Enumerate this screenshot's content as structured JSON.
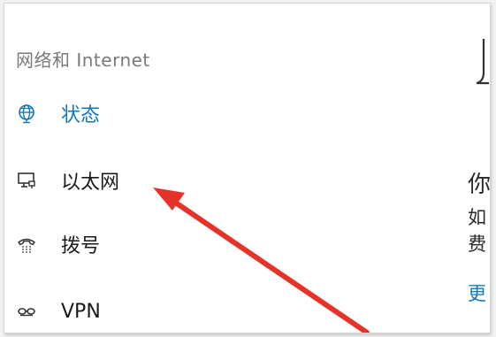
{
  "sidebar": {
    "section_title": "网络和 Internet",
    "items": [
      {
        "label": "状态",
        "icon": "globe-icon",
        "active": true
      },
      {
        "label": "以太网",
        "icon": "monitor-ethernet-icon",
        "active": false
      },
      {
        "label": "拨号",
        "icon": "dialup-phone-icon",
        "active": false
      },
      {
        "label": "VPN",
        "icon": "vpn-icon",
        "active": false
      }
    ]
  },
  "right_pane": {
    "glyph_large": "你",
    "glyph_line1": "如",
    "glyph_line2": "费",
    "link_glyph": "更"
  },
  "colors": {
    "accent": "#1479b8",
    "arrow": "#e5332a",
    "section_title": "#7a7a7a"
  }
}
